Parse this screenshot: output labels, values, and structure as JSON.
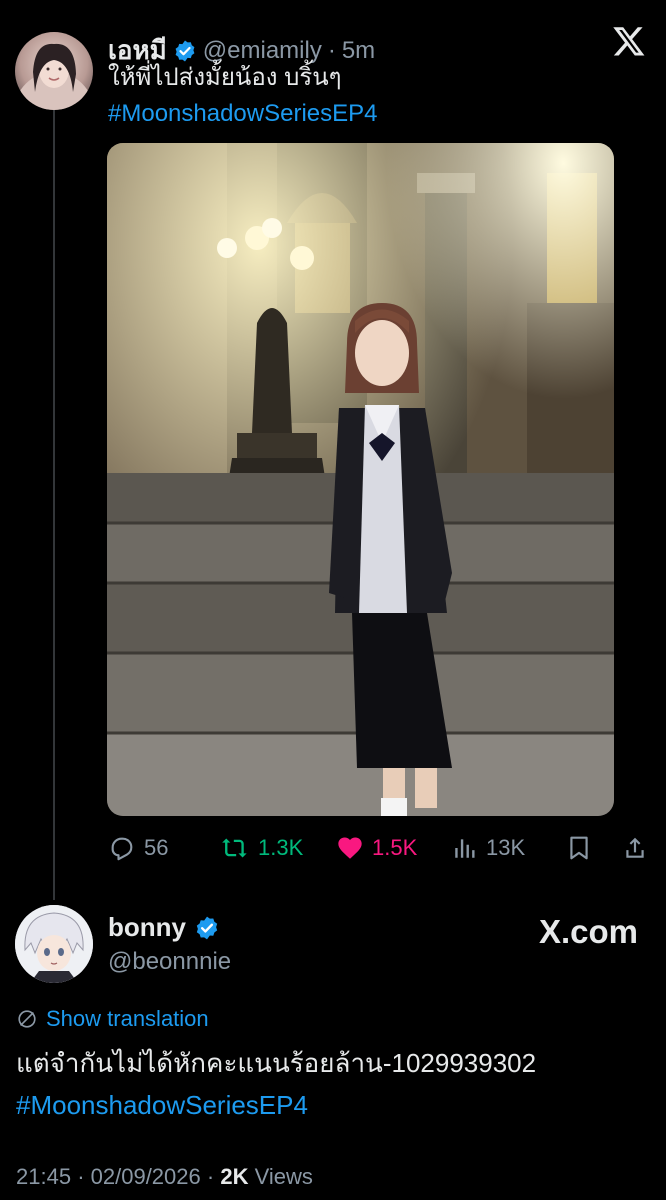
{
  "quoted_tweet": {
    "display_name": "เอหมี",
    "handle": "@emiamily",
    "separator": "·",
    "time_ago": "5m",
    "text": "ให้พี่ไปส่งมั้ยน้อง บริ้นๆ",
    "hashtag": "#MoonshadowSeriesEP4",
    "avatar_icon": "profile-photo",
    "photo_icon": "photo-girl-in-school-uniform",
    "actions": {
      "replies": "56",
      "reposts": "1.3K",
      "likes": "1.5K",
      "views": "13K"
    },
    "colors": {
      "repost": "#00ba7c",
      "like": "#f91880",
      "link": "#1d9bf0",
      "verified": "#1d9bf0"
    }
  },
  "main_tweet": {
    "display_name": "bonny",
    "handle": "@beonnnie",
    "watermark": "X.com",
    "show_translation": "Show translation",
    "text": "แต่จำกันไม่ได้หักคะแนนร้อยล้าน-1029939302",
    "hashtag": "#MoonshadowSeriesEP4",
    "time": "21:45",
    "separator": "·",
    "date": "02/09/2026",
    "separator2": "·",
    "views_count": "2K",
    "views_label": "Views"
  }
}
